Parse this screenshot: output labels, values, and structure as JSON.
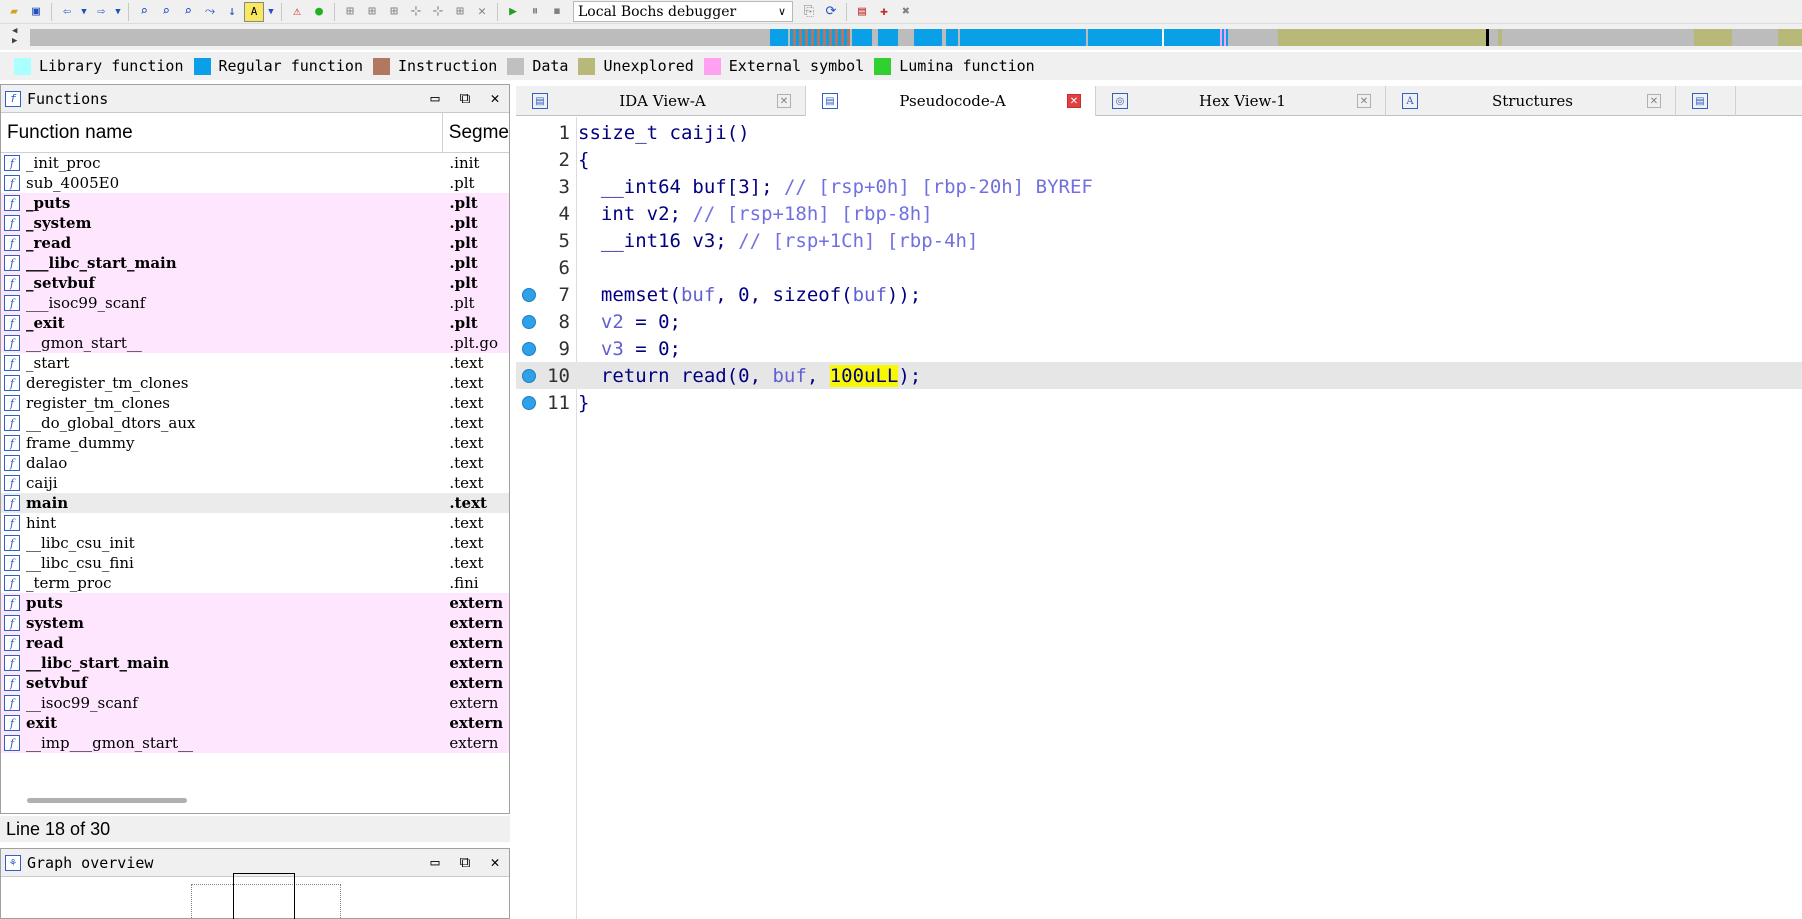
{
  "toolbar": {
    "debugger": "Local Bochs debugger"
  },
  "legend": [
    {
      "label": "Library function",
      "color": "#aaffff"
    },
    {
      "label": "Regular function",
      "color": "#0aa0e8"
    },
    {
      "label": "Instruction",
      "color": "#b07860"
    },
    {
      "label": "Data",
      "color": "#c0c0c0"
    },
    {
      "label": "Unexplored",
      "color": "#b8b878"
    },
    {
      "label": "External symbol",
      "color": "#ffa0f0"
    },
    {
      "label": "Lumina function",
      "color": "#30d030"
    }
  ],
  "functions_panel": {
    "title": "Functions",
    "col_name": "Function name",
    "col_segment": "Segme",
    "rows": [
      {
        "name": "_init_proc",
        "seg": ".init"
      },
      {
        "name": "sub_4005E0",
        "seg": ".plt"
      },
      {
        "name": "_puts",
        "seg": ".plt"
      },
      {
        "name": "_system",
        "seg": ".plt"
      },
      {
        "name": "_read",
        "seg": ".plt"
      },
      {
        "name": "___libc_start_main",
        "seg": ".plt"
      },
      {
        "name": "_setvbuf",
        "seg": ".plt"
      },
      {
        "name": "___isoc99_scanf",
        "seg": ".plt"
      },
      {
        "name": "_exit",
        "seg": ".plt"
      },
      {
        "name": "__gmon_start__",
        "seg": ".plt.go"
      },
      {
        "name": "_start",
        "seg": ".text"
      },
      {
        "name": "deregister_tm_clones",
        "seg": ".text"
      },
      {
        "name": "register_tm_clones",
        "seg": ".text"
      },
      {
        "name": "__do_global_dtors_aux",
        "seg": ".text"
      },
      {
        "name": "frame_dummy",
        "seg": ".text"
      },
      {
        "name": "dalao",
        "seg": ".text"
      },
      {
        "name": "caiji",
        "seg": ".text"
      },
      {
        "name": "main",
        "seg": ".text"
      },
      {
        "name": "hint",
        "seg": ".text"
      },
      {
        "name": "__libc_csu_init",
        "seg": ".text"
      },
      {
        "name": "__libc_csu_fini",
        "seg": ".text"
      },
      {
        "name": "_term_proc",
        "seg": ".fini"
      },
      {
        "name": "puts",
        "seg": "extern"
      },
      {
        "name": "system",
        "seg": "extern"
      },
      {
        "name": "read",
        "seg": "extern"
      },
      {
        "name": "__libc_start_main",
        "seg": "extern"
      },
      {
        "name": "setvbuf",
        "seg": "extern"
      },
      {
        "name": "__isoc99_scanf",
        "seg": "extern"
      },
      {
        "name": "exit",
        "seg": "extern"
      },
      {
        "name": "__imp___gmon_start__",
        "seg": "extern"
      }
    ],
    "status": "Line 18 of 30"
  },
  "graph_overview": {
    "title": "Graph overview"
  },
  "tabs": [
    {
      "label": "IDA View-A"
    },
    {
      "label": "Pseudocode-A"
    },
    {
      "label": "Hex View-1"
    },
    {
      "label": "Structures"
    }
  ],
  "code": {
    "line_numbers": [
      "1",
      "2",
      "3",
      "4",
      "5",
      "6",
      "7",
      "8",
      "9",
      "10",
      "11"
    ],
    "signature": "ssize_t caiji()",
    "open_brace": "{",
    "close_brace": "}",
    "decl1_type": "__int64",
    "decl1_var": "buf",
    "decl1_dim": "[3];",
    "decl1_comment": "// [rsp+0h] [rbp-20h] BYREF",
    "decl2_type": "int",
    "decl2_var": "v2;",
    "decl2_comment": "// [rsp+18h] [rbp-8h]",
    "decl3_type": "__int16",
    "decl3_var": "v3;",
    "decl3_comment": "// [rsp+1Ch] [rbp-4h]",
    "memset_fn": "memset(",
    "memset_buf": "buf",
    "memset_mid": ", 0, ",
    "memset_sizeof": "sizeof(",
    "memset_buf2": "buf",
    "memset_end": "));",
    "v2": "v2",
    "v2_rest": " = 0;",
    "v3": "v3",
    "v3_rest": " = 0;",
    "ret_kw": "return read(0, ",
    "ret_buf": "buf",
    "ret_sep": ", ",
    "ret_num": "100uLL",
    "ret_end": ");"
  }
}
